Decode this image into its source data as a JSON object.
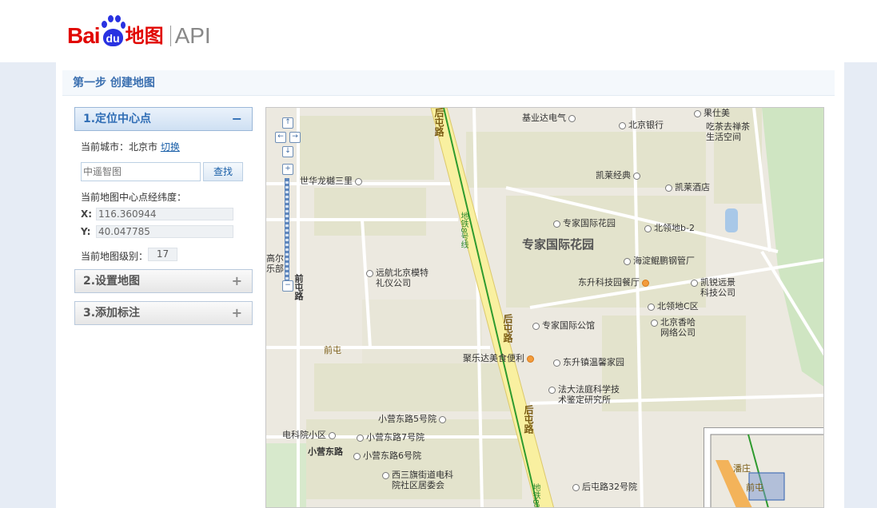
{
  "header": {
    "logo_bai": "Bai",
    "logo_du": "du",
    "logo_map": "地图",
    "logo_api": "API",
    "brand_red": "#e10601",
    "brand_blue": "#2932e1"
  },
  "step_title": "第一步 创建地图",
  "sidebar": {
    "sections": [
      {
        "label": "1.定位中心点",
        "sign": "−",
        "expanded": true
      },
      {
        "label": "2.设置地图",
        "sign": "+",
        "expanded": false
      },
      {
        "label": "3.添加标注",
        "sign": "+",
        "expanded": false
      }
    ],
    "current_city_label": "当前城市：北京市",
    "switch_link": "切换",
    "search_placeholder": "中遥智图",
    "search_button": "查找",
    "center_label": "当前地图中心点经纬度：",
    "x_label": "X:",
    "x_value": "116.360944",
    "y_label": "Y:",
    "y_value": "40.047785",
    "level_label": "当前地图级别：",
    "level_value": "17"
  },
  "map": {
    "area_label": "专家国际花园",
    "roads": [
      "后屯路",
      "后屯路",
      "后屯路",
      "小营东路",
      "前屯路",
      "高尔乐部",
      "地铁8号线",
      "地铁8号线"
    ],
    "pois": [
      "基业达电气",
      "北京银行",
      "果仕美",
      "吃茶去禅茶生活空间",
      "世华龙樾三里",
      "凯莱经典",
      "凯莱酒店",
      "专家国际花园",
      "北领地b-2",
      "海淀鲲鹏钢管厂",
      "远航北京模特礼仪公司",
      "东升科技园餐厅",
      "凯锐远景科技公司",
      "北领地C区",
      "专家国际公馆",
      "北京香哈网络公司",
      "前屯",
      "聚乐达美食便利",
      "东升镇温馨家园",
      "法大法庭科学技术鉴定研究所",
      "小营东路5号院",
      "电科院小区",
      "小营东路7号院",
      "小营东路6号院",
      "西三旗街道电科院社区居委会",
      "后屯路32号院",
      "潘庄",
      "前屯"
    ]
  }
}
